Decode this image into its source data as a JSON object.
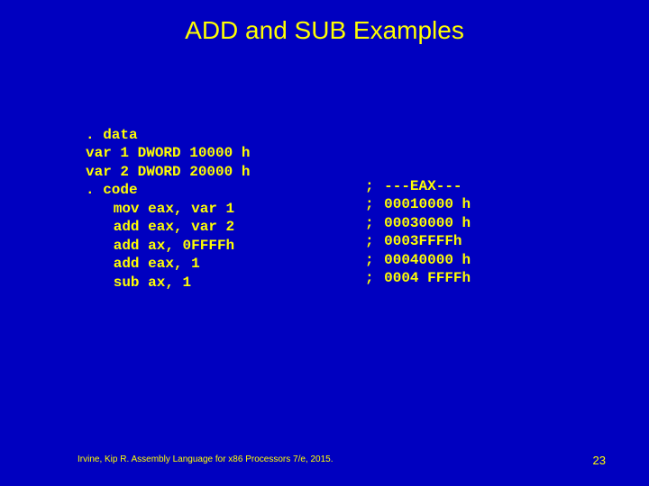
{
  "title": "ADD and SUB Examples",
  "code": {
    "lines": [
      {
        "text": ". data",
        "indent": false
      },
      {
        "text": "var 1 DWORD 10000 h",
        "indent": false
      },
      {
        "text": "var 2 DWORD 20000 h",
        "indent": false
      },
      {
        "text": ". code",
        "indent": false
      },
      {
        "text": "mov eax, var 1",
        "indent": true
      },
      {
        "text": "add eax, var 2",
        "indent": true
      },
      {
        "text": "add ax, 0FFFFh",
        "indent": true
      },
      {
        "text": "add eax, 1",
        "indent": true
      },
      {
        "text": "sub ax, 1",
        "indent": true
      }
    ]
  },
  "comments": [
    "---EAX---",
    "00010000 h",
    "00030000 h",
    "0003FFFFh",
    "00040000 h",
    "0004 FFFFh"
  ],
  "comment_prefix": ";",
  "footer": "Irvine, Kip R. Assembly Language for x86 Processors 7/e, 2015.",
  "page_number": "23"
}
